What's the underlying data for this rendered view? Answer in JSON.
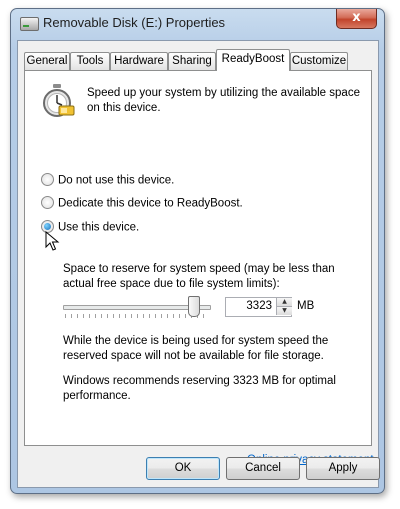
{
  "window": {
    "title": "Removable Disk (E:) Properties",
    "close_glyph": "x"
  },
  "tabs": [
    {
      "label": "General",
      "active": false
    },
    {
      "label": "Tools",
      "active": false
    },
    {
      "label": "Hardware",
      "active": false
    },
    {
      "label": "Sharing",
      "active": false
    },
    {
      "label": "ReadyBoost",
      "active": true
    },
    {
      "label": "Customize",
      "active": false
    }
  ],
  "readyboost": {
    "icon": "readyboost-stopwatch-icon",
    "intro": "Speed up your system by utilizing the available space on this device.",
    "options": [
      {
        "label": "Do not use this device.",
        "checked": false
      },
      {
        "label": "Dedicate this device to ReadyBoost.",
        "checked": false
      },
      {
        "label": "Use this device.",
        "checked": true
      }
    ],
    "reserve_label": "Space to reserve for system speed (may be less than actual free space due to file system limits):",
    "reserve_value": "3323",
    "reserve_unit": "MB",
    "slider_level": 0.93,
    "note_storage": "While the device is being used for system speed the reserved space will not be available for file storage.",
    "note_recommend": "Windows recommends reserving 3323 MB for optimal performance.",
    "privacy_link": "Online privacy statement"
  },
  "buttons": {
    "ok": "OK",
    "cancel": "Cancel",
    "apply": "Apply"
  }
}
